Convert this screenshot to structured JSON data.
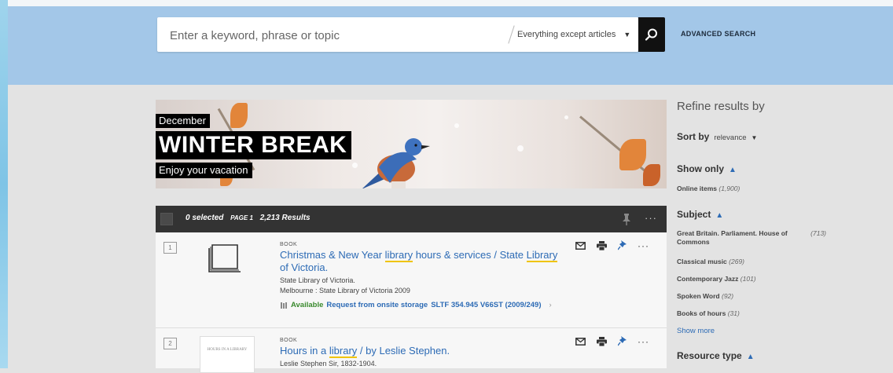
{
  "search": {
    "placeholder": "Enter a keyword, phrase or topic",
    "scope": "Everything except articles",
    "advanced": "ADVANCED SEARCH"
  },
  "banner": {
    "month": "December",
    "title": "WINTER BREAK",
    "subtitle": "Enjoy your vacation"
  },
  "results_bar": {
    "selected": "0 selected",
    "page": "PAGE 1",
    "count": "2,213 Results"
  },
  "results": [
    {
      "number": "1",
      "type": "BOOK",
      "title_parts": [
        "Christmas & New Year ",
        "library",
        " hours & services / State ",
        "Library",
        " of Victoria."
      ],
      "author": "State Library of Victoria.",
      "publisher": "Melbourne : State Library of Victoria 2009",
      "status": "Available",
      "request": "Request from onsite storage",
      "callnumber": "SLTF 354.945 V66ST (2009/249)"
    },
    {
      "number": "2",
      "type": "BOOK",
      "title_parts": [
        "Hours in a ",
        "library",
        " / by Leslie Stephen."
      ],
      "author": "Leslie Stephen Sir, 1832-1904.",
      "thumb_text": "HOURS IN A LIBRARY"
    }
  ],
  "sidebar": {
    "refine": "Refine results by",
    "sort_label": "Sort by",
    "sort_value": "relevance",
    "show_only": "Show only",
    "online_items": "Online items",
    "online_count": "(1,900)",
    "subject": "Subject",
    "subjects": [
      {
        "label": "Great Britain. Parliament. House of Commons",
        "count": "(713)"
      },
      {
        "label": "Classical music",
        "count": "(269)"
      },
      {
        "label": "Contemporary Jazz",
        "count": "(101)"
      },
      {
        "label": "Spoken Word",
        "count": "(92)"
      },
      {
        "label": "Books of hours",
        "count": "(31)"
      }
    ],
    "show_more": "Show more",
    "resource_type": "Resource type"
  },
  "colors": {
    "header": "#a3c7e8",
    "link": "#2d6bb5",
    "available": "#3a8a2e",
    "highlight": "#f0c400"
  }
}
